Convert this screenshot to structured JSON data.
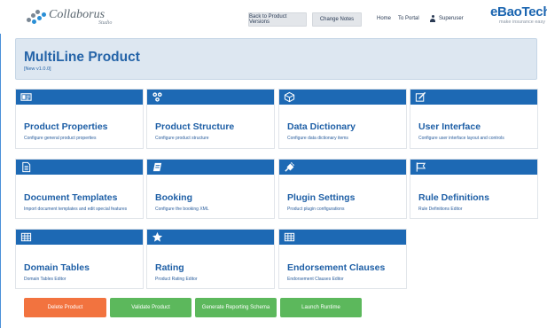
{
  "colors": {
    "accent": "#1d69b4",
    "title": "#1e5fa6",
    "header_bg": "#dde7f1",
    "danger": "#f2733f",
    "success": "#5cb85c"
  },
  "topbar": {
    "logo_name": "Collaborus",
    "logo_sub": "Studio",
    "back_button": "Back to Product Versions",
    "notes_button": "Change Notes",
    "home_link": "Home",
    "portal_link": "To Portal",
    "user_name": "Superuser",
    "user_icon": "user-icon",
    "brand_name": "eBaoTech",
    "brand_tagline": "make insurance easy"
  },
  "header": {
    "title": "MultiLine Product",
    "version": "[New v1.0.0]"
  },
  "tiles": [
    {
      "title": "Product Properties",
      "desc": "Configure general product properties",
      "icon": "id-card-icon"
    },
    {
      "title": "Product Structure",
      "desc": "Configure product structure",
      "icon": "structure-icon"
    },
    {
      "title": "Data Dictionary",
      "desc": "Configure data dictionary items",
      "icon": "cube-icon"
    },
    {
      "title": "User Interface",
      "desc": "Configure user interface layout and controls",
      "icon": "edit-icon"
    },
    {
      "title": "Document Templates",
      "desc": "Import document templates and edit special features",
      "icon": "document-icon"
    },
    {
      "title": "Booking",
      "desc": "Configure the booking XML",
      "icon": "book-icon"
    },
    {
      "title": "Plugin Settings",
      "desc": "Product plugin configurations",
      "icon": "plug-icon"
    },
    {
      "title": "Rule Definitions",
      "desc": "Rule Definitions Editor",
      "icon": "flag-icon"
    },
    {
      "title": "Domain Tables",
      "desc": "Domain Tables Editor",
      "icon": "table-icon"
    },
    {
      "title": "Rating",
      "desc": "Product Rating Editor",
      "icon": "star-icon"
    },
    {
      "title": "Endorsement Clauses",
      "desc": "Endorsement Clauses Editor",
      "icon": "table-icon"
    }
  ],
  "actions": {
    "delete": "Delete Product",
    "validate": "Validate Product",
    "reporting": "Generate Reporting Schema",
    "runtime": "Launch Runtime"
  }
}
